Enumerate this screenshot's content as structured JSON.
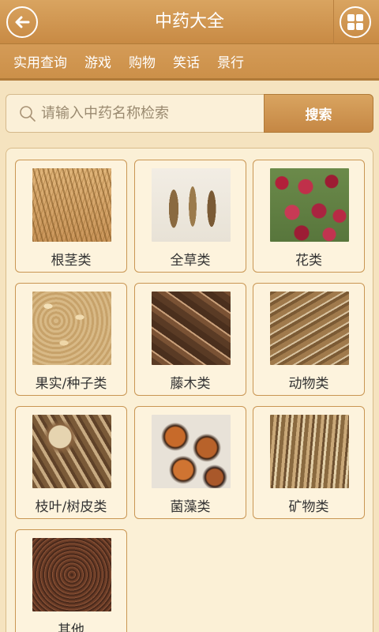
{
  "header": {
    "title": "中药大全",
    "back_icon": "back-arrow-icon",
    "grid_icon": "grid-menu-icon"
  },
  "nav": {
    "items": [
      "实用查询",
      "游戏",
      "购物",
      "笑话",
      "景行"
    ]
  },
  "search": {
    "placeholder": "请输入中药名称检索",
    "button_label": "搜索"
  },
  "categories": [
    {
      "label": "根茎类"
    },
    {
      "label": "全草类"
    },
    {
      "label": "花类"
    },
    {
      "label": "果实/种子类"
    },
    {
      "label": "藤木类"
    },
    {
      "label": "动物类"
    },
    {
      "label": "枝叶/树皮类"
    },
    {
      "label": "菌藻类"
    },
    {
      "label": "矿物类"
    },
    {
      "label": "其他"
    }
  ]
}
